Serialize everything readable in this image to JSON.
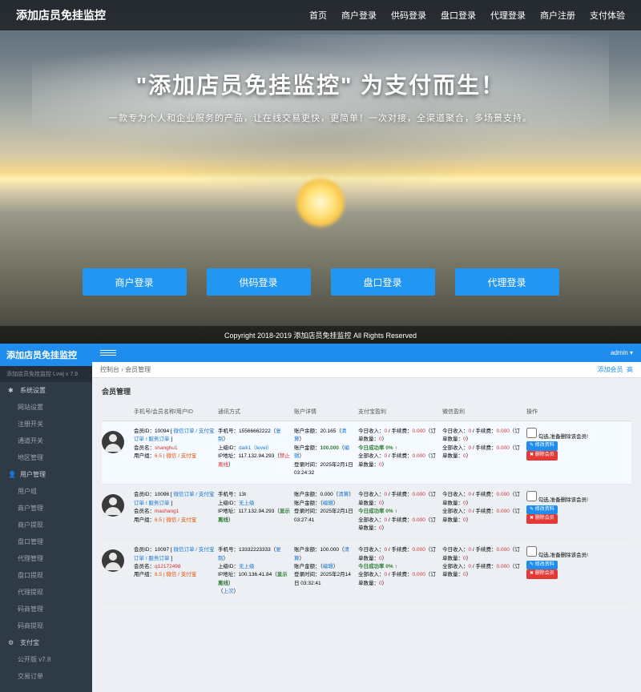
{
  "landing": {
    "title": "添加店员免挂监控",
    "nav": [
      "首页",
      "商户登录",
      "供码登录",
      "盘口登录",
      "代理登录",
      "商户注册",
      "支付体验"
    ],
    "hero_title": "\"添加店员免挂监控\"  为支付而生！",
    "hero_sub": "一款专为个人和企业服务的产品，让在线交易更快，更简单！一次对接，全渠道聚合，多场景支持。",
    "buttons": [
      "商户登录",
      "供码登录",
      "盘口登录",
      "代理登录"
    ],
    "copyright": "Copyright 2018-2019 添加店员免挂监控 All Rights Reserved"
  },
  "admin": {
    "brand": "添加店员免挂监控",
    "sidebar_user": "添加店员免挂监控   Lvwj   v 7.9",
    "topbar_user": "admin",
    "menu_groups": [
      {
        "label": "系统设置",
        "icon": "cog",
        "items": [
          "网站设置",
          "注册开关",
          "通道开关",
          "地区管理"
        ]
      },
      {
        "label": "用户管理",
        "icon": "user",
        "items": [
          "用户组",
          "商户管理",
          "商户提现",
          "盘口管理",
          "代理管理",
          "盘口提现",
          "代理提现",
          "码商管理",
          "码商提现"
        ]
      },
      {
        "label": "支付宝",
        "icon": "gear",
        "items": [
          "公开版 v7.8",
          "交易订单"
        ]
      }
    ],
    "crumb": {
      "a": "控制台",
      "b": "会员管理",
      "right1": "添加会员",
      "right2": "高"
    },
    "panel_title": "会员管理",
    "headers": [
      "",
      "手机号/会员名称/用户ID",
      "通讯方式",
      "账户详情",
      "支付宝盈利",
      "微信盈利",
      "操作"
    ],
    "action": {
      "checkbox_label": "勾选,准备删除该会员!",
      "modify": "修改资料",
      "delete": "删除会员"
    },
    "rows": [
      {
        "id": "10094",
        "links": "微信订单 / 支付宝订单 / 服务订单",
        "member": "shanghu1",
        "group": "6.5 | 微信 / 支付宝",
        "phone": "15566662222",
        "phone_suffix": "复制",
        "superior": "daili1（level）",
        "ip": "117.132.94.293",
        "ip_suffix": "禁止离线",
        "balance": "20.165",
        "balance_suffix": "清算",
        "quota": "100.000",
        "quota_suffix": "编辑",
        "reg_time": "2025年2月1日 03:24:32",
        "alipay_today_in": "0",
        "alipay_fee": "0.000",
        "alipay_orders": "0",
        "alipay_success": "0%",
        "alipay_total_in": "0",
        "alipay_total_fee": "0.000",
        "alipay_total_orders": "0",
        "wx_today_in": "0",
        "wx_fee": "0.000",
        "wx_orders": "0",
        "wx_total_in": "0",
        "wx_total_fee": "0.000",
        "wx_total_orders": "0"
      },
      {
        "id": "10096",
        "links": "微信订单 / 支付宝订单 / 服务订单",
        "member": "mashang1",
        "group": "6.5 | 微信 / 支付宝",
        "phone": "13t",
        "phone_suffix": "",
        "superior": "无上级",
        "ip": "117.132.94.293",
        "ip_suffix": "显示离线",
        "balance": "0.000",
        "balance_suffix": "清算",
        "quota": "",
        "quota_suffix": "编辑",
        "reg_time": "2025年2月1日 03:27:41",
        "alipay_today_in": "0",
        "alipay_fee": "0.000",
        "alipay_orders": "0",
        "alipay_success": "0%",
        "alipay_total_in": "0",
        "alipay_total_fee": "0.000",
        "alipay_total_orders": "0",
        "wx_today_in": "0",
        "wx_fee": "0.000",
        "wx_orders": "0",
        "wx_total_in": "0",
        "wx_total_fee": "0.000",
        "wx_total_orders": "0"
      },
      {
        "id": "10097",
        "links": "微信订单 / 支付宝订单 / 服务订单",
        "member": "q12172498",
        "group": "6.5 | 微信 / 支付宝",
        "phone": "13332223333",
        "phone_suffix": "复制",
        "superior": "无上级",
        "ip": "100.136.41.84",
        "ip_suffix": "显示离线",
        "ip_extra": "上次",
        "balance": "100.000",
        "balance_suffix": "清算",
        "quota": "",
        "quota_suffix": "编辑",
        "reg_time": "2025年2月14日 03:32:41",
        "alipay_today_in": "0",
        "alipay_fee": "0.000",
        "alipay_orders": "0",
        "alipay_success": "0%",
        "alipay_total_in": "0",
        "alipay_total_fee": "0.000",
        "alipay_total_orders": "0",
        "wx_today_in": "0",
        "wx_fee": "0.000",
        "wx_orders": "0",
        "wx_total_in": "0",
        "wx_total_fee": "0.000",
        "wx_total_orders": "0"
      }
    ],
    "labels": {
      "member_id": "会员ID：",
      "member_name": "会员名：",
      "group": "用户组：",
      "phone": "手机号：",
      "superior": "上级ID：",
      "ip": "IP地址：",
      "balance": "账户余额：",
      "quota": "账户金额：",
      "reg": "登录时间：",
      "today_in": "今日收入：",
      "fee": "手续费：",
      "orders": "订单数量：",
      "success": "今日成功率",
      "total_in": "全部收入：",
      "order_cnt": "订单数量："
    }
  }
}
